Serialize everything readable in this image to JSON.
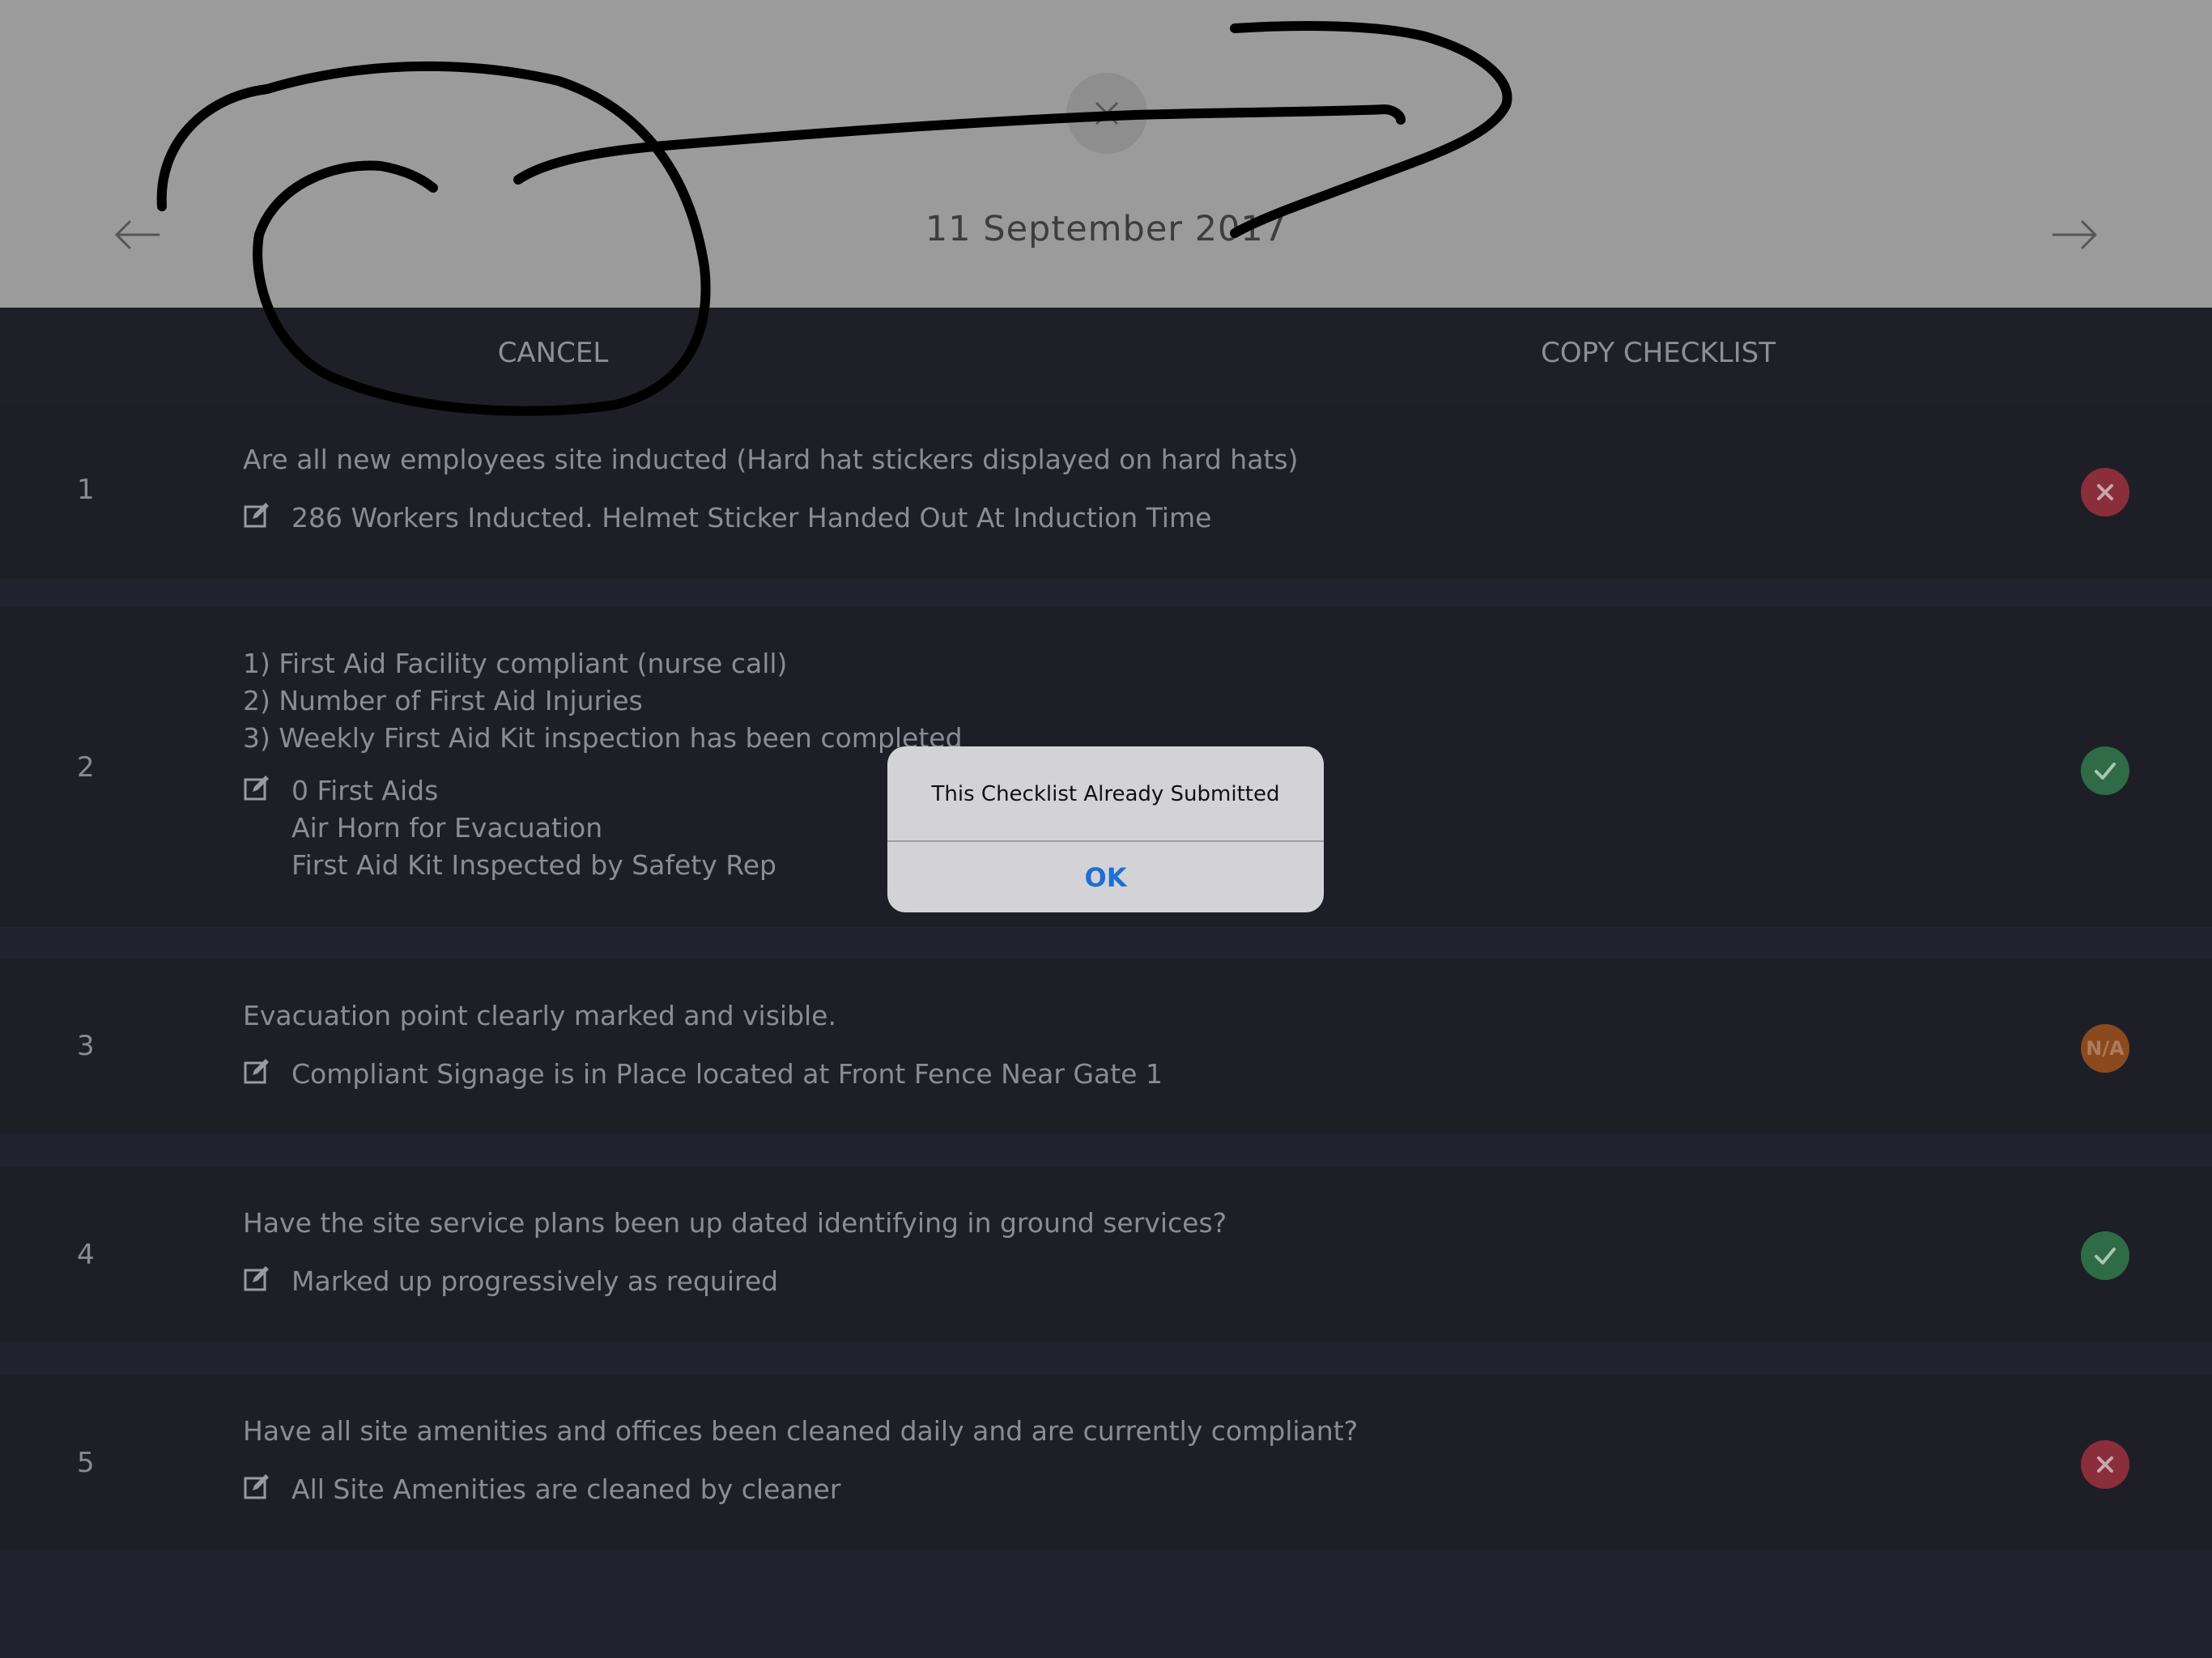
{
  "header": {
    "date_title": "11 September 2017",
    "close_icon": "close-icon",
    "prev_icon": "arrow-left-icon",
    "next_icon": "arrow-right-icon"
  },
  "actions": {
    "cancel_label": "CANCEL",
    "copy_label": "COPY CHECKLIST"
  },
  "checklist": [
    {
      "number": "1",
      "question": "Are all new employees site inducted (Hard hat stickers displayed on hard hats)",
      "note": "286 Workers Inducted. Helmet Sticker Handed Out At Induction Time",
      "status": "fail"
    },
    {
      "number": "2",
      "question": "1) First Aid Facility compliant (nurse call)\n2) Number of First Aid Injuries\n3) Weekly First Aid Kit inspection has been completed",
      "note": "0 First Aids\nAir Horn for Evacuation\nFirst Aid Kit Inspected by Safety Rep",
      "status": "pass"
    },
    {
      "number": "3",
      "question": "Evacuation point clearly marked and visible.",
      "note": "Compliant Signage is in Place located at Front Fence Near Gate 1",
      "status": "na",
      "status_label": "N/A"
    },
    {
      "number": "4",
      "question": "Have the site service plans been up dated identifying in ground services?",
      "note": "Marked up progressively as required",
      "status": "pass"
    },
    {
      "number": "5",
      "question": "Have all site amenities and offices been cleaned daily and are currently compliant?",
      "note": "All Site Amenities are cleaned by cleaner",
      "status": "fail"
    }
  ],
  "alert": {
    "message": "This Checklist Already Submitted",
    "ok_label": "OK"
  },
  "colors": {
    "fail": "#8b2e3c",
    "pass": "#2e6b46",
    "na": "#8a4a1e",
    "accent": "#1f6fd3"
  }
}
